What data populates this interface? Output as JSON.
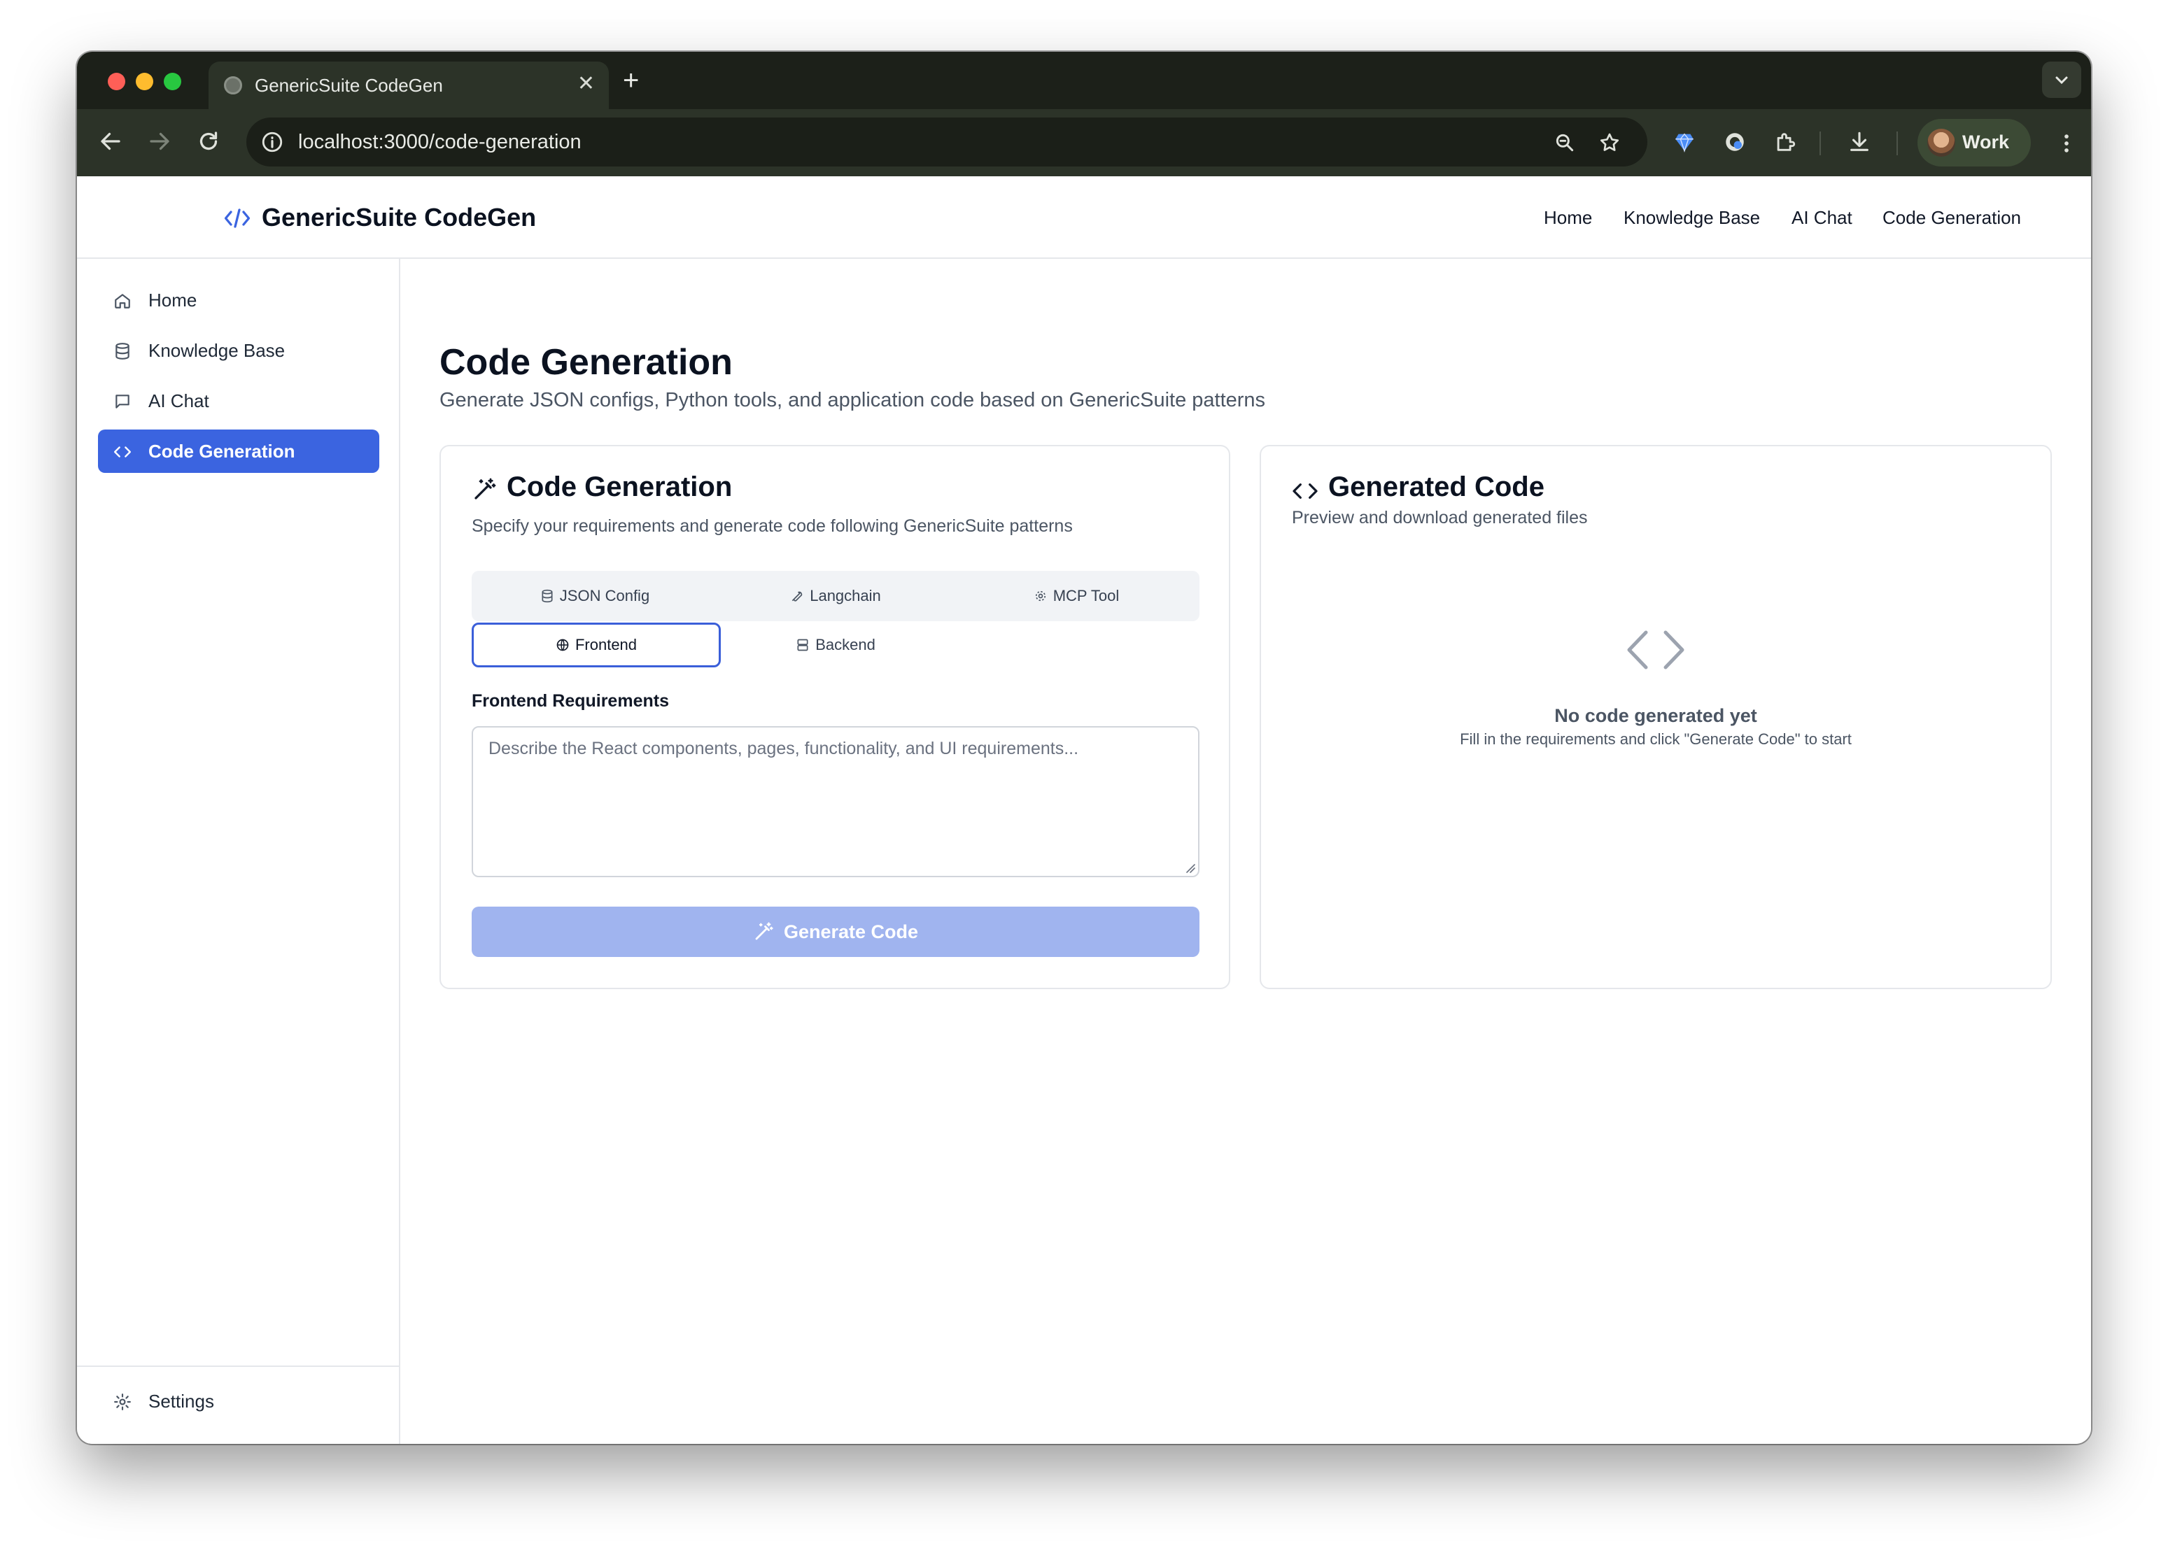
{
  "browser": {
    "tab_title": "GenericSuite CodeGen",
    "url": "localhost:3000/code-generation",
    "profile_label": "Work"
  },
  "app": {
    "brand": "GenericSuite CodeGen",
    "top_nav": [
      "Home",
      "Knowledge Base",
      "AI Chat",
      "Code Generation"
    ]
  },
  "sidebar": {
    "items": [
      {
        "label": "Home",
        "icon": "home-icon"
      },
      {
        "label": "Knowledge Base",
        "icon": "database-icon"
      },
      {
        "label": "AI Chat",
        "icon": "message-square-icon"
      },
      {
        "label": "Code Generation",
        "icon": "code-icon",
        "active": true
      }
    ],
    "settings_label": "Settings"
  },
  "main": {
    "title": "Code Generation",
    "subtitle": "Generate JSON configs, Python tools, and application code based on GenericSuite patterns"
  },
  "generator": {
    "title": "Code Generation",
    "description": "Specify your requirements and generate code following GenericSuite patterns",
    "tabs": [
      {
        "label": "JSON Config",
        "icon": "database-icon"
      },
      {
        "label": "Langchain",
        "icon": "wrench-icon"
      },
      {
        "label": "MCP Tool",
        "icon": "cog-icon"
      },
      {
        "label": "Frontend",
        "icon": "globe-icon",
        "active": true
      },
      {
        "label": "Backend",
        "icon": "server-icon"
      }
    ],
    "field_label": "Frontend Requirements",
    "field_placeholder": "Describe the React components, pages, functionality, and UI requirements...",
    "field_value": "",
    "button_label": "Generate Code"
  },
  "output": {
    "title": "Generated Code",
    "description": "Preview and download generated files",
    "empty_title": "No code generated yet",
    "empty_desc": "Fill in the requirements and click \"Generate Code\" to start"
  },
  "colors": {
    "accent": "#3b64e0",
    "button_disabled": "#a0b4ef",
    "border": "#e5e7eb"
  }
}
